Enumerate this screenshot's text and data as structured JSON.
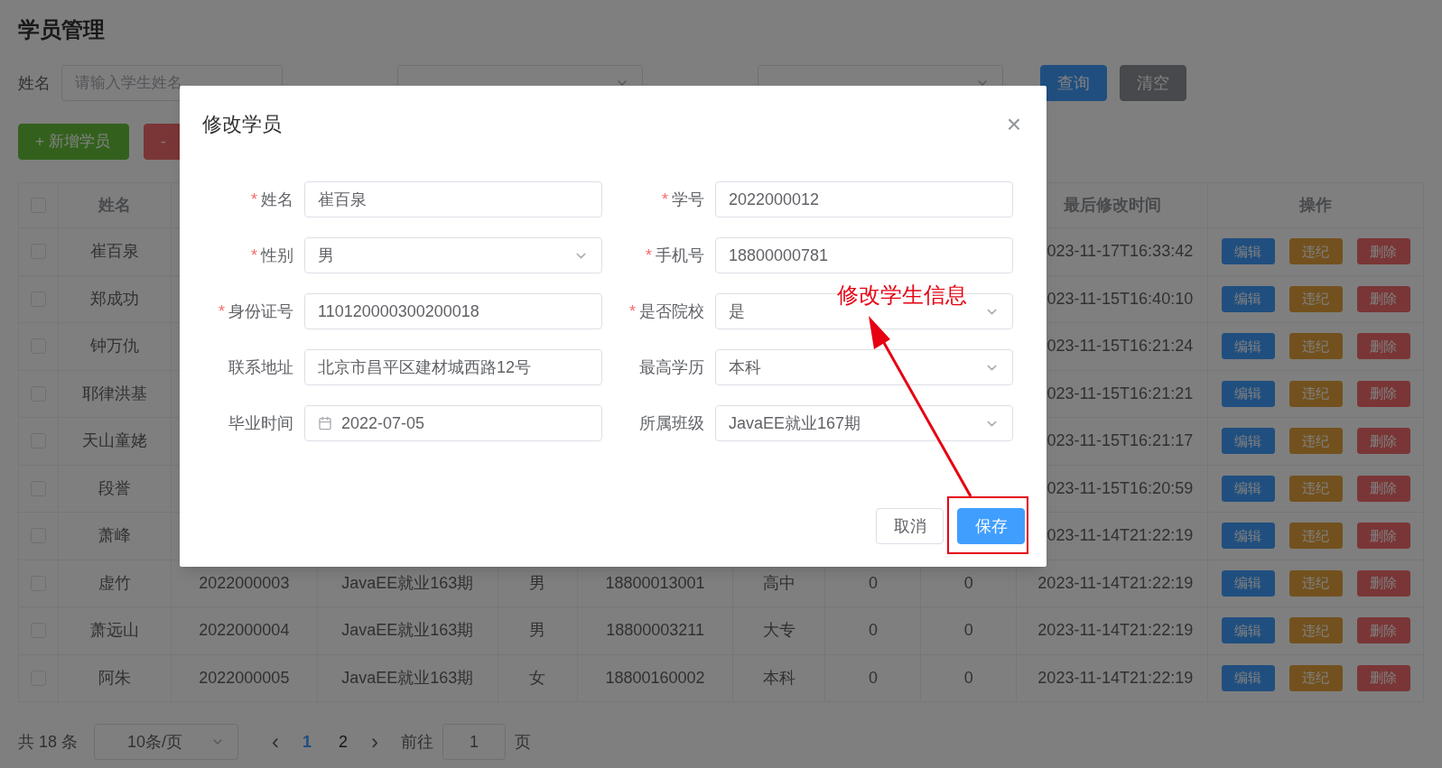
{
  "page_title": "学员管理",
  "filters": [
    {
      "label": "姓名",
      "kind": "input",
      "placeholder": "请输入学生姓名"
    },
    {
      "kind": "select"
    },
    {
      "kind": "select"
    }
  ],
  "filter_buttons": [
    {
      "label": "查询",
      "kind": "primary"
    },
    {
      "label": "清空",
      "kind": "neutral"
    }
  ],
  "toolbar": [
    {
      "label": "+ 新增学员",
      "kind": "success"
    },
    {
      "label": "-",
      "kind": "danger"
    }
  ],
  "table": {
    "all_checked": false,
    "columns": {
      "name": "姓名",
      "updated": "最后修改时间",
      "actions": "操作"
    },
    "rows": [
      {
        "checked": false,
        "name": "崔百泉",
        "updated": "023-11-17T16:33:42",
        "actions": [
          {
            "label": "编辑",
            "kind": "primary"
          },
          {
            "label": "违纪",
            "kind": "warning"
          },
          {
            "label": "删除",
            "kind": "danger"
          }
        ]
      },
      {
        "checked": false,
        "name": "郑成功",
        "updated": "023-11-15T16:40:10",
        "actions": [
          {
            "label": "编辑",
            "kind": "primary"
          },
          {
            "label": "违纪",
            "kind": "warning"
          },
          {
            "label": "删除",
            "kind": "danger"
          }
        ]
      },
      {
        "checked": false,
        "name": "钟万仇",
        "updated": "023-11-15T16:21:24",
        "actions": [
          {
            "label": "编辑",
            "kind": "primary"
          },
          {
            "label": "违纪",
            "kind": "warning"
          },
          {
            "label": "删除",
            "kind": "danger"
          }
        ]
      },
      {
        "checked": false,
        "name": "耶律洪基",
        "updated": "023-11-15T16:21:21",
        "actions": [
          {
            "label": "编辑",
            "kind": "primary"
          },
          {
            "label": "违纪",
            "kind": "warning"
          },
          {
            "label": "删除",
            "kind": "danger"
          }
        ]
      },
      {
        "checked": false,
        "name": "天山童姥",
        "updated": "023-11-15T16:21:17",
        "actions": [
          {
            "label": "编辑",
            "kind": "primary"
          },
          {
            "label": "违纪",
            "kind": "warning"
          },
          {
            "label": "删除",
            "kind": "danger"
          }
        ]
      },
      {
        "checked": false,
        "name": "段誉",
        "updated": "023-11-15T16:20:59",
        "actions": [
          {
            "label": "编辑",
            "kind": "primary"
          },
          {
            "label": "违纪",
            "kind": "warning"
          },
          {
            "label": "删除",
            "kind": "danger"
          }
        ]
      },
      {
        "checked": false,
        "name": "萧峰",
        "updated": "023-11-14T21:22:19",
        "actions": [
          {
            "label": "编辑",
            "kind": "primary"
          },
          {
            "label": "违纪",
            "kind": "warning"
          },
          {
            "label": "删除",
            "kind": "danger"
          }
        ]
      },
      {
        "checked": false,
        "name": "虚竹",
        "student_id": "2022000003",
        "class": "JavaEE就业163期",
        "gender": "男",
        "phone": "18800013001",
        "degree": "高中",
        "column_8": "0",
        "column_9": "0",
        "updated": "2023-11-14T21:22:19",
        "actions": [
          {
            "label": "编辑",
            "kind": "primary"
          },
          {
            "label": "违纪",
            "kind": "warning"
          },
          {
            "label": "删除",
            "kind": "danger"
          }
        ]
      },
      {
        "checked": false,
        "name": "萧远山",
        "student_id": "2022000004",
        "class": "JavaEE就业163期",
        "gender": "男",
        "phone": "18800003211",
        "degree": "大专",
        "column_8": "0",
        "column_9": "0",
        "updated": "2023-11-14T21:22:19",
        "actions": [
          {
            "label": "编辑",
            "kind": "primary"
          },
          {
            "label": "违纪",
            "kind": "warning"
          },
          {
            "label": "删除",
            "kind": "danger"
          }
        ]
      },
      {
        "checked": false,
        "name": "阿朱",
        "student_id": "2022000005",
        "class": "JavaEE就业163期",
        "gender": "女",
        "phone": "18800160002",
        "degree": "本科",
        "column_8": "0",
        "column_9": "0",
        "updated": "2023-11-14T21:22:19",
        "actions": [
          {
            "label": "编辑",
            "kind": "primary"
          },
          {
            "label": "违纪",
            "kind": "warning"
          },
          {
            "label": "删除",
            "kind": "danger"
          }
        ]
      }
    ]
  },
  "pagination": {
    "total": "共 18 条",
    "page_size": "10条/页",
    "prev": "‹",
    "pages": [
      {
        "label": "1",
        "selected": true
      },
      {
        "label": "2",
        "selected": false
      }
    ],
    "next": "›",
    "goto_label": "前往",
    "goto_value": "1",
    "goto_suffix": "页"
  },
  "dialog": {
    "title": "修改学员",
    "close": "×",
    "fields": [
      {
        "required_mark": "*",
        "label": "姓名",
        "kind": "input",
        "value": "崔百泉"
      },
      {
        "required_mark": "*",
        "label": "学号",
        "kind": "input",
        "value": "2022000012"
      },
      {
        "required_mark": "*",
        "label": "性别",
        "kind": "select",
        "value": "男"
      },
      {
        "required_mark": "*",
        "label": "手机号",
        "kind": "input",
        "value": "18800000781"
      },
      {
        "required_mark": "*",
        "label": "身份证号",
        "kind": "input",
        "value": "110120000300200018"
      },
      {
        "required_mark": "*",
        "label": "是否院校",
        "kind": "select",
        "value": "是"
      },
      {
        "label": "联系地址",
        "kind": "input",
        "value": "北京市昌平区建材城西路12号"
      },
      {
        "label": "最高学历",
        "kind": "select",
        "value": "本科"
      },
      {
        "label": "毕业时间",
        "kind": "date",
        "value": "2022-07-05"
      },
      {
        "label": "所属班级",
        "kind": "select",
        "value": "JavaEE就业167期"
      }
    ],
    "buttons": [
      {
        "label": "取消",
        "kind": "default"
      },
      {
        "label": "保存",
        "kind": "primary",
        "highlighted": true
      }
    ],
    "annotation": {
      "text": "修改学生信息"
    }
  }
}
